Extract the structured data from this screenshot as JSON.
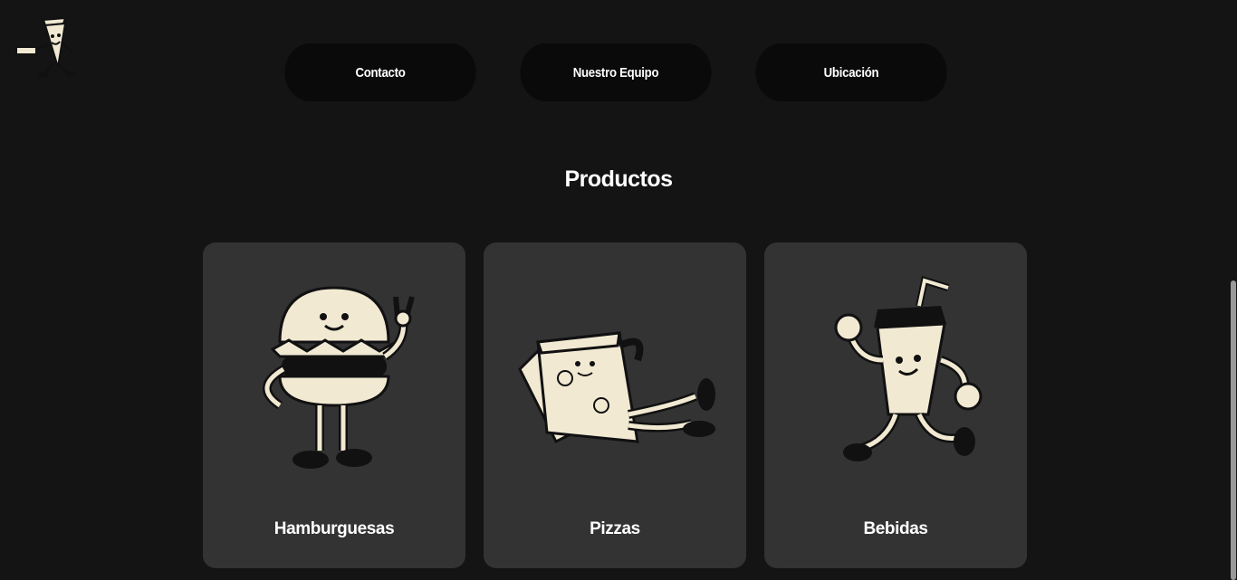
{
  "header": {
    "logo_icon": "pizza-mascot-icon",
    "nav": [
      {
        "label": "Contacto"
      },
      {
        "label": "Nuestro Equipo"
      },
      {
        "label": "Ubicación"
      }
    ]
  },
  "products": {
    "title": "Productos",
    "items": [
      {
        "label": "Hamburguesas",
        "icon": "burger-mascot-icon"
      },
      {
        "label": "Pizzas",
        "icon": "pizza-slice-mascot-icon"
      },
      {
        "label": "Bebidas",
        "icon": "drink-cup-mascot-icon"
      }
    ]
  },
  "colors": {
    "background": "#141414",
    "nav_button": "#0a0a0a",
    "card": "#333333",
    "illustration_fill": "#f1e9d2",
    "illustration_line": "#111111"
  }
}
